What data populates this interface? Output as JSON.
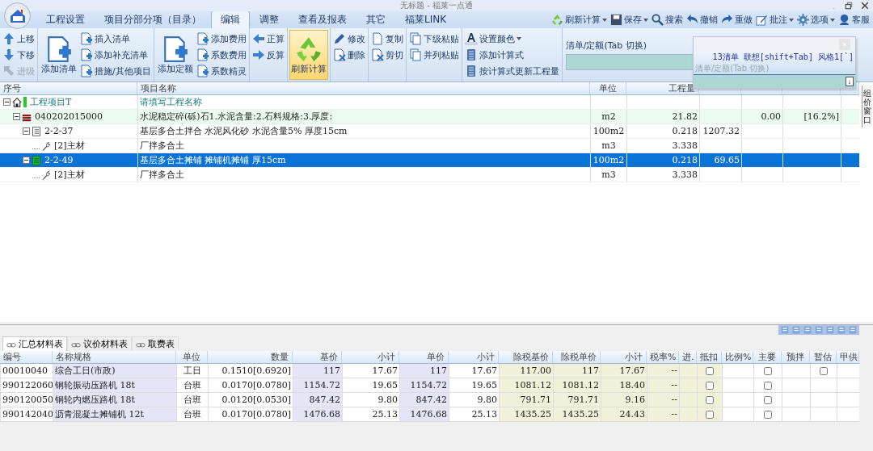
{
  "window": {
    "title": "无标题 - 福莱一点通"
  },
  "menu_tabs": [
    {
      "label": "工程设置",
      "selected": false
    },
    {
      "label": "项目分部分项（目录）",
      "selected": false
    },
    {
      "label": "编辑",
      "selected": true
    },
    {
      "label": "调整",
      "selected": false
    },
    {
      "label": "查看及报表",
      "selected": false
    },
    {
      "label": "其它",
      "selected": false
    },
    {
      "label": "福莱LINK",
      "selected": false
    }
  ],
  "quick_toolbar": [
    {
      "label": "刷新计算",
      "dropdown": true
    },
    {
      "label": "保存",
      "dropdown": true
    },
    {
      "label": "搜索",
      "dropdown": false
    },
    {
      "label": "撤销",
      "dropdown": false
    },
    {
      "label": "重做",
      "dropdown": false
    },
    {
      "label": "批注",
      "dropdown": true
    },
    {
      "label": "选项",
      "dropdown": true
    },
    {
      "label": "客服",
      "dropdown": false
    }
  ],
  "ribbon": {
    "groups": [
      {
        "buttons": [
          {
            "label": "上移",
            "kind": "small",
            "disabled": false
          },
          {
            "label": "下移",
            "kind": "small",
            "disabled": false
          },
          {
            "label": "进级",
            "kind": "small",
            "disabled": true
          }
        ]
      },
      {
        "buttons": [
          {
            "label": "添加清单",
            "kind": "big",
            "disabled": false
          },
          {
            "label": "插入清单",
            "kind": "small",
            "disabled": false
          },
          {
            "label": "添加补充清单",
            "kind": "small",
            "disabled": false
          },
          {
            "label": "措施/其他项目",
            "kind": "small",
            "disabled": false
          }
        ]
      },
      {
        "buttons": [
          {
            "label": "添加定额",
            "kind": "big",
            "disabled": false
          },
          {
            "label": "添加费用",
            "kind": "small",
            "disabled": false
          },
          {
            "label": "系数费用",
            "kind": "small",
            "disabled": false
          },
          {
            "label": "系数精灵",
            "kind": "small",
            "disabled": false
          }
        ]
      },
      {
        "buttons": [
          {
            "label": "正算",
            "kind": "small",
            "disabled": false
          },
          {
            "label": "反算",
            "kind": "small",
            "disabled": false
          }
        ]
      },
      {
        "buttons": [
          {
            "label": "刷新计算",
            "kind": "big",
            "disabled": false,
            "highlighted": true
          }
        ]
      },
      {
        "buttons": [
          {
            "label": "修改",
            "kind": "small",
            "disabled": false
          },
          {
            "label": "删除",
            "kind": "small",
            "disabled": false
          }
        ]
      },
      {
        "buttons": [
          {
            "label": "复制",
            "kind": "small",
            "disabled": false
          },
          {
            "label": "剪切",
            "kind": "small",
            "disabled": false
          }
        ]
      },
      {
        "buttons": [
          {
            "label": "下级粘贴",
            "kind": "small",
            "disabled": false
          },
          {
            "label": "并列粘贴",
            "kind": "small",
            "disabled": false
          }
        ]
      },
      {
        "buttons": [
          {
            "label": "设置颜色",
            "kind": "small",
            "disabled": false,
            "dropdown": true
          },
          {
            "label": "添加计算式",
            "kind": "small",
            "disabled": false
          },
          {
            "label": "按计算式更新工程量",
            "kind": "small",
            "disabled": false
          }
        ]
      }
    ],
    "entry_box": {
      "label": "清单/定额(Tab 切换)"
    }
  },
  "popup": {
    "hint": "13清单 联想[shift+Tab] 风格1[`]",
    "label": "清单/定额(Tab 切换)",
    "button": "↓"
  },
  "side_tab": {
    "label": "组价窗口"
  },
  "tree_table": {
    "columns": [
      "序号",
      "项目名称",
      "单位",
      "工程量"
    ],
    "rows": [
      {
        "kind": "project",
        "code": "工程项目T",
        "name": "请填写工程名称",
        "expanded": true,
        "selected": false,
        "children": [
          {
            "kind": "item",
            "code": "040202015000",
            "name": "水泥稳定碎(砾)石1.水泥含量:2.石料规格:3.厚度:",
            "unit": "m2",
            "quantity": "21.82",
            "column_6": "0.00",
            "column_7": "[16.2%]",
            "expanded": true,
            "selected": false,
            "children": [
              {
                "kind": "quota",
                "code": "2-2-37",
                "name": "基层多合土拌合 水泥风化砂 水泥含量5% 厚度15cm",
                "unit": "100m2",
                "quantity": "0.218",
                "column_5": "1207.32",
                "expanded": true,
                "selected": false,
                "children": [
                  {
                    "kind": "material",
                    "code": "[2]主材",
                    "name": "厂拌多合土",
                    "unit": "m3",
                    "quantity": "3.338",
                    "selected": false
                  }
                ]
              },
              {
                "kind": "quota",
                "code": "2-2-49",
                "name": "基层多合土摊铺 摊铺机摊铺 厚15cm",
                "unit": "100m2",
                "quantity": "0.218",
                "column_5": "69.65",
                "expanded": true,
                "selected": true,
                "children": [
                  {
                    "kind": "material",
                    "code": "[2]主材",
                    "name": "厂拌多合土",
                    "unit": "m3",
                    "quantity": "3.338",
                    "selected": false
                  }
                ]
              }
            ]
          }
        ]
      }
    ]
  },
  "bottom_tabs": [
    {
      "label": "汇总材料表",
      "selected": true
    },
    {
      "label": "议价材料表",
      "selected": false
    },
    {
      "label": "取费表",
      "selected": false
    }
  ],
  "material_table": {
    "columns": [
      "编号",
      "名称规格",
      "单位",
      "数量",
      "基价",
      "小计",
      "单价",
      "小计",
      "除税基价",
      "除税单价",
      "小计",
      "税率%",
      "进.",
      "抵扣",
      "比例%",
      "主要",
      "预拌",
      "暂估",
      "甲供"
    ],
    "rows": [
      {
        "values": [
          "00010040",
          "综合工日(市政)",
          "工日",
          "0.1510[0.6920]",
          "117",
          "17.67",
          "117",
          "17.67",
          "117.00",
          "117",
          "17.67",
          "--"
        ],
        "deduct_checked": false,
        "main_checked": false,
        "estimate_checked": false
      },
      {
        "values": [
          "990122060",
          "钢轮振动压路机 18t",
          "台班",
          "0.0170[0.0780]",
          "1154.72",
          "19.65",
          "1154.72",
          "19.65",
          "1081.12",
          "1081.12",
          "18.40",
          "--"
        ],
        "deduct_checked": false,
        "main_checked": false
      },
      {
        "values": [
          "990120050",
          "钢轮内燃压路机 18t",
          "台班",
          "0.0120[0.0530]",
          "847.42",
          "9.80",
          "847.42",
          "9.80",
          "791.71",
          "791.71",
          "9.16",
          "--"
        ],
        "deduct_checked": false,
        "main_checked": false
      },
      {
        "values": [
          "990142040",
          "沥青混凝土摊铺机 12t",
          "台班",
          "0.0170[0.0780]",
          "1476.68",
          "25.13",
          "1476.68",
          "25.13",
          "1435.25",
          "1435.25",
          "24.43",
          "--"
        ],
        "deduct_checked": false,
        "main_checked": false
      }
    ]
  }
}
